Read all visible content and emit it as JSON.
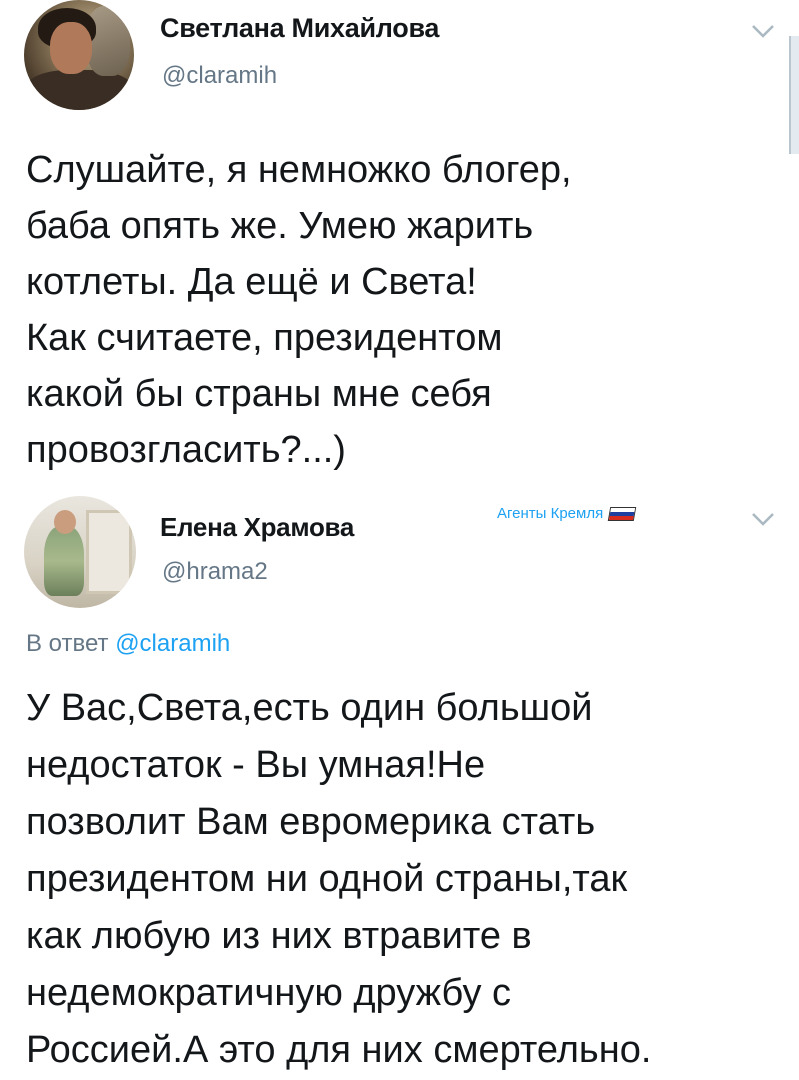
{
  "tweets": [
    {
      "author_name": "Светлана Михайлова",
      "handle": "@claramih",
      "avatar_icon": "avatar-photo",
      "text_lines": [
        "Слушайте, я немножко блогер,",
        "баба опять же. Умею жарить",
        "котлеты. Да ещё и Света!",
        "Как считаете, президентом",
        "какой бы страны мне себя",
        "провозгласить?...)"
      ]
    },
    {
      "author_name": "Елена Храмова",
      "handle": "@hrama2",
      "avatar_icon": "avatar-photo",
      "badge": "Агенты Кремля",
      "badge_icon": "russian-flag-icon",
      "reply_prefix": "В ответ",
      "reply_mention": "@claramih",
      "text_lines": [
        "У Вас,Света,есть один большой",
        "недостаток - Вы умная!Не",
        "позволит Вам евромерика стать",
        "президентом ни одной страны,так",
        "как любую из них втравите в",
        "недемократичную дружбу с",
        "Россией.А это для них смертельно."
      ]
    }
  ],
  "colors": {
    "accent": "#1da1f2",
    "secondary_text": "#657786",
    "primary_text": "#14171a",
    "chevron": "#aab8c2",
    "flag": [
      "#ffffff",
      "#1f3fa0",
      "#d52b1e"
    ]
  }
}
